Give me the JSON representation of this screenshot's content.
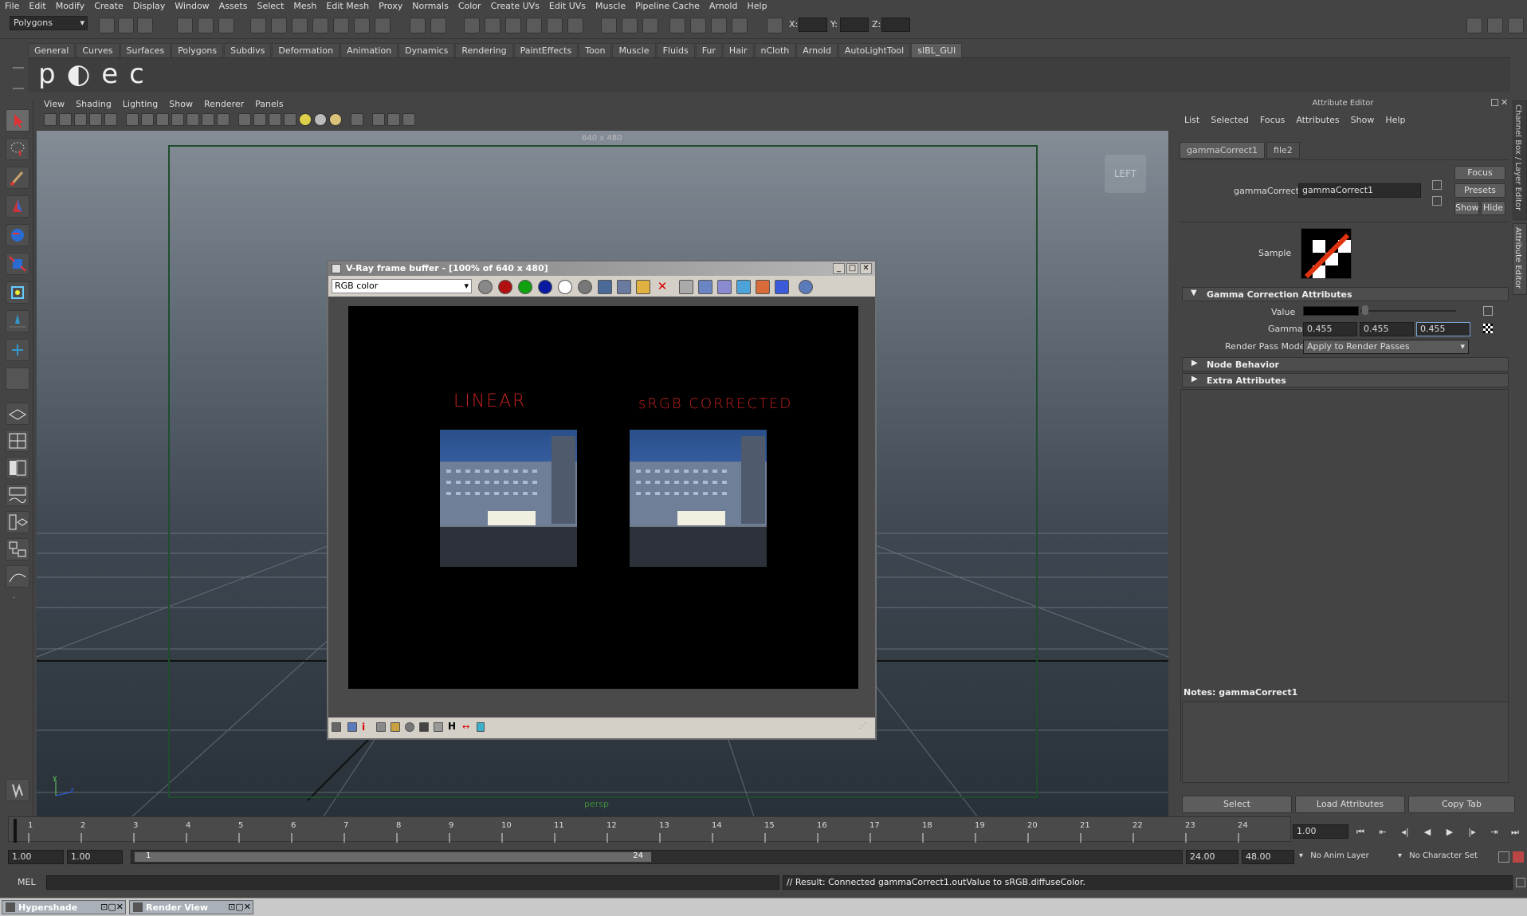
{
  "menubar": [
    "File",
    "Edit",
    "Modify",
    "Create",
    "Display",
    "Window",
    "Assets",
    "Select",
    "Mesh",
    "Edit Mesh",
    "Proxy",
    "Normals",
    "Color",
    "Create UVs",
    "Edit UVs",
    "Muscle",
    "Pipeline Cache",
    "Arnold",
    "Help"
  ],
  "status": {
    "mode_select": "Polygons",
    "x_label": "X:",
    "y_label": "Y:",
    "z_label": "Z:"
  },
  "shelf": {
    "tabs": [
      "General",
      "Curves",
      "Surfaces",
      "Polygons",
      "Subdivs",
      "Deformation",
      "Animation",
      "Dynamics",
      "Rendering",
      "PaintEffects",
      "Toon",
      "Muscle",
      "Fluids",
      "Fur",
      "Hair",
      "nCloth",
      "Arnold",
      "AutoLightTool",
      "sIBL_GUI"
    ],
    "active_tab": "sIBL_GUI",
    "letters": "p◐ec"
  },
  "panel": {
    "menu": [
      "View",
      "Shading",
      "Lighting",
      "Show",
      "Renderer",
      "Panels"
    ],
    "resolution": "640 x 480",
    "camera_label": "persp",
    "view_badge": "LEFT"
  },
  "vfb": {
    "title": "V-Ray frame buffer - [100% of 640 x 480]",
    "channel": "RGB color",
    "left_caption": "LINEAR",
    "right_caption": "sRGB CORRECTED",
    "colors": {
      "red": "#b01010",
      "green": "#10a010",
      "blue": "#0a1aa0"
    }
  },
  "attribute_editor": {
    "title": "Attribute Editor",
    "menu": [
      "List",
      "Selected",
      "Focus",
      "Attributes",
      "Show",
      "Help"
    ],
    "node_tabs": [
      "gammaCorrect1",
      "file2"
    ],
    "node_type_label": "gammaCorrect:",
    "node_name": "gammaCorrect1",
    "focus_btn": "Focus",
    "presets_btn": "Presets",
    "show_btn": "Show",
    "hide_btn": "Hide",
    "sample_label": "Sample",
    "section_gamma": "Gamma Correction Attributes",
    "value_label": "Value",
    "gamma_label": "Gamma",
    "gamma": [
      "0.455",
      "0.455",
      "0.455"
    ],
    "render_pass_label": "Render Pass Mode",
    "render_pass_value": "Apply to Render Passes",
    "section_node_behavior": "Node Behavior",
    "section_extra": "Extra Attributes",
    "notes_label": "Notes:  gammaCorrect1",
    "select_btn": "Select",
    "load_btn": "Load Attributes",
    "copy_btn": "Copy Tab"
  },
  "side_tabs": {
    "channel_box": "Channel Box / Layer Editor",
    "attr": "Attribute Editor"
  },
  "timeline": {
    "ticks": [
      "1",
      "2",
      "3",
      "4",
      "5",
      "6",
      "7",
      "8",
      "9",
      "10",
      "11",
      "12",
      "13",
      "14",
      "15",
      "16",
      "17",
      "18",
      "19",
      "20",
      "21",
      "22",
      "23",
      "24"
    ],
    "current_frame": "1.00"
  },
  "range": {
    "start": "1.00",
    "start2": "1.00",
    "range_start": "1",
    "range_end": "24",
    "end": "24.00",
    "end2": "48.00",
    "anim_layer": "No Anim Layer",
    "char_set": "No Character Set"
  },
  "cmd": {
    "lang": "MEL",
    "result": "// Result: Connected gammaCorrect1.outValue to sRGB.diffuseColor."
  },
  "taskbar": {
    "hypershade": "Hypershade",
    "render_view": "Render View"
  }
}
